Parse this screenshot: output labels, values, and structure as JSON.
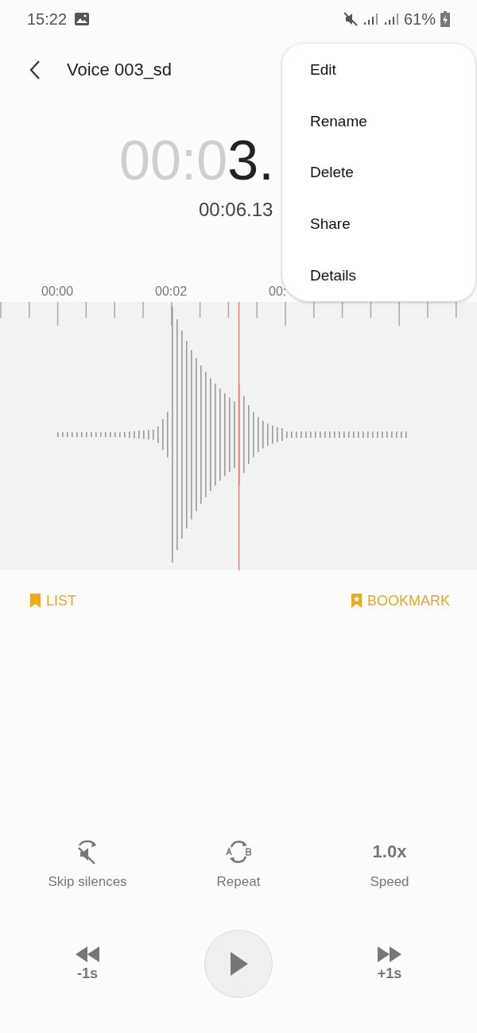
{
  "status_bar": {
    "time": "15:22",
    "battery": "61%"
  },
  "header": {
    "title": "Voice 003_sd"
  },
  "timer": {
    "elapsed_dim": "00:0",
    "elapsed": "3.",
    "total": "00:06.13"
  },
  "ruler": {
    "labels": [
      "00:00",
      "00:02",
      "00:"
    ]
  },
  "bookmarks": {
    "list": "LIST",
    "bookmark": "BOOKMARK"
  },
  "options": [
    {
      "kind": "skip",
      "label": "Skip silences"
    },
    {
      "kind": "repeat",
      "label": "Repeat"
    },
    {
      "kind": "speed",
      "value": "1.0x",
      "label": "Speed"
    }
  ],
  "playback": {
    "rewind": "-1s",
    "forward": "+1s"
  },
  "menu": [
    {
      "label": "Edit"
    },
    {
      "label": "Rename"
    },
    {
      "label": "Delete"
    },
    {
      "label": "Share"
    },
    {
      "label": "Details"
    }
  ]
}
